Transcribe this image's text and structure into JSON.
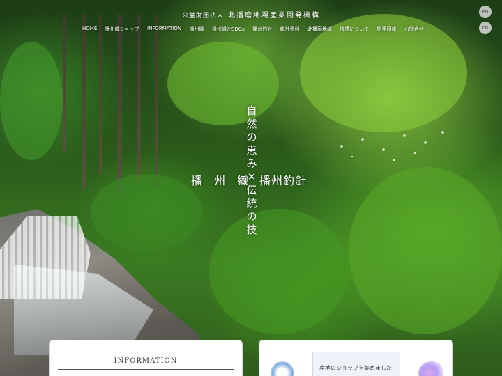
{
  "header": {
    "org_prefix": "公益財団法人",
    "org_name": "北播磨地場産業開発機構"
  },
  "nav": {
    "items": [
      {
        "label": "HOME"
      },
      {
        "label": "播州織ショップ"
      },
      {
        "label": "INFORMATION"
      },
      {
        "label": "播州織"
      },
      {
        "label": "播州織とSDGs"
      },
      {
        "label": "播州釣針"
      },
      {
        "label": "統計資料"
      },
      {
        "label": "北播磨地域"
      },
      {
        "label": "機構について"
      },
      {
        "label": "関連団体"
      },
      {
        "label": "お問合せ"
      }
    ]
  },
  "lang_buttons": [
    {
      "label": "en"
    },
    {
      "label": "cn"
    }
  ],
  "hero": {
    "vertical_chars": [
      "自",
      "然",
      "の",
      "恵",
      "み",
      "✕",
      "伝",
      "統",
      "の",
      "技"
    ],
    "left_text": "播 州 織",
    "right_text": "播州釣針"
  },
  "cards": {
    "information_title": "INFORMATION",
    "shop_label": "産地のショップを集めました"
  },
  "colors": {
    "forest_dark": "#1f4a14",
    "forest_light": "#96d246",
    "card_bg": "#ffffff",
    "shop_label_bg": "#eef3fb"
  }
}
